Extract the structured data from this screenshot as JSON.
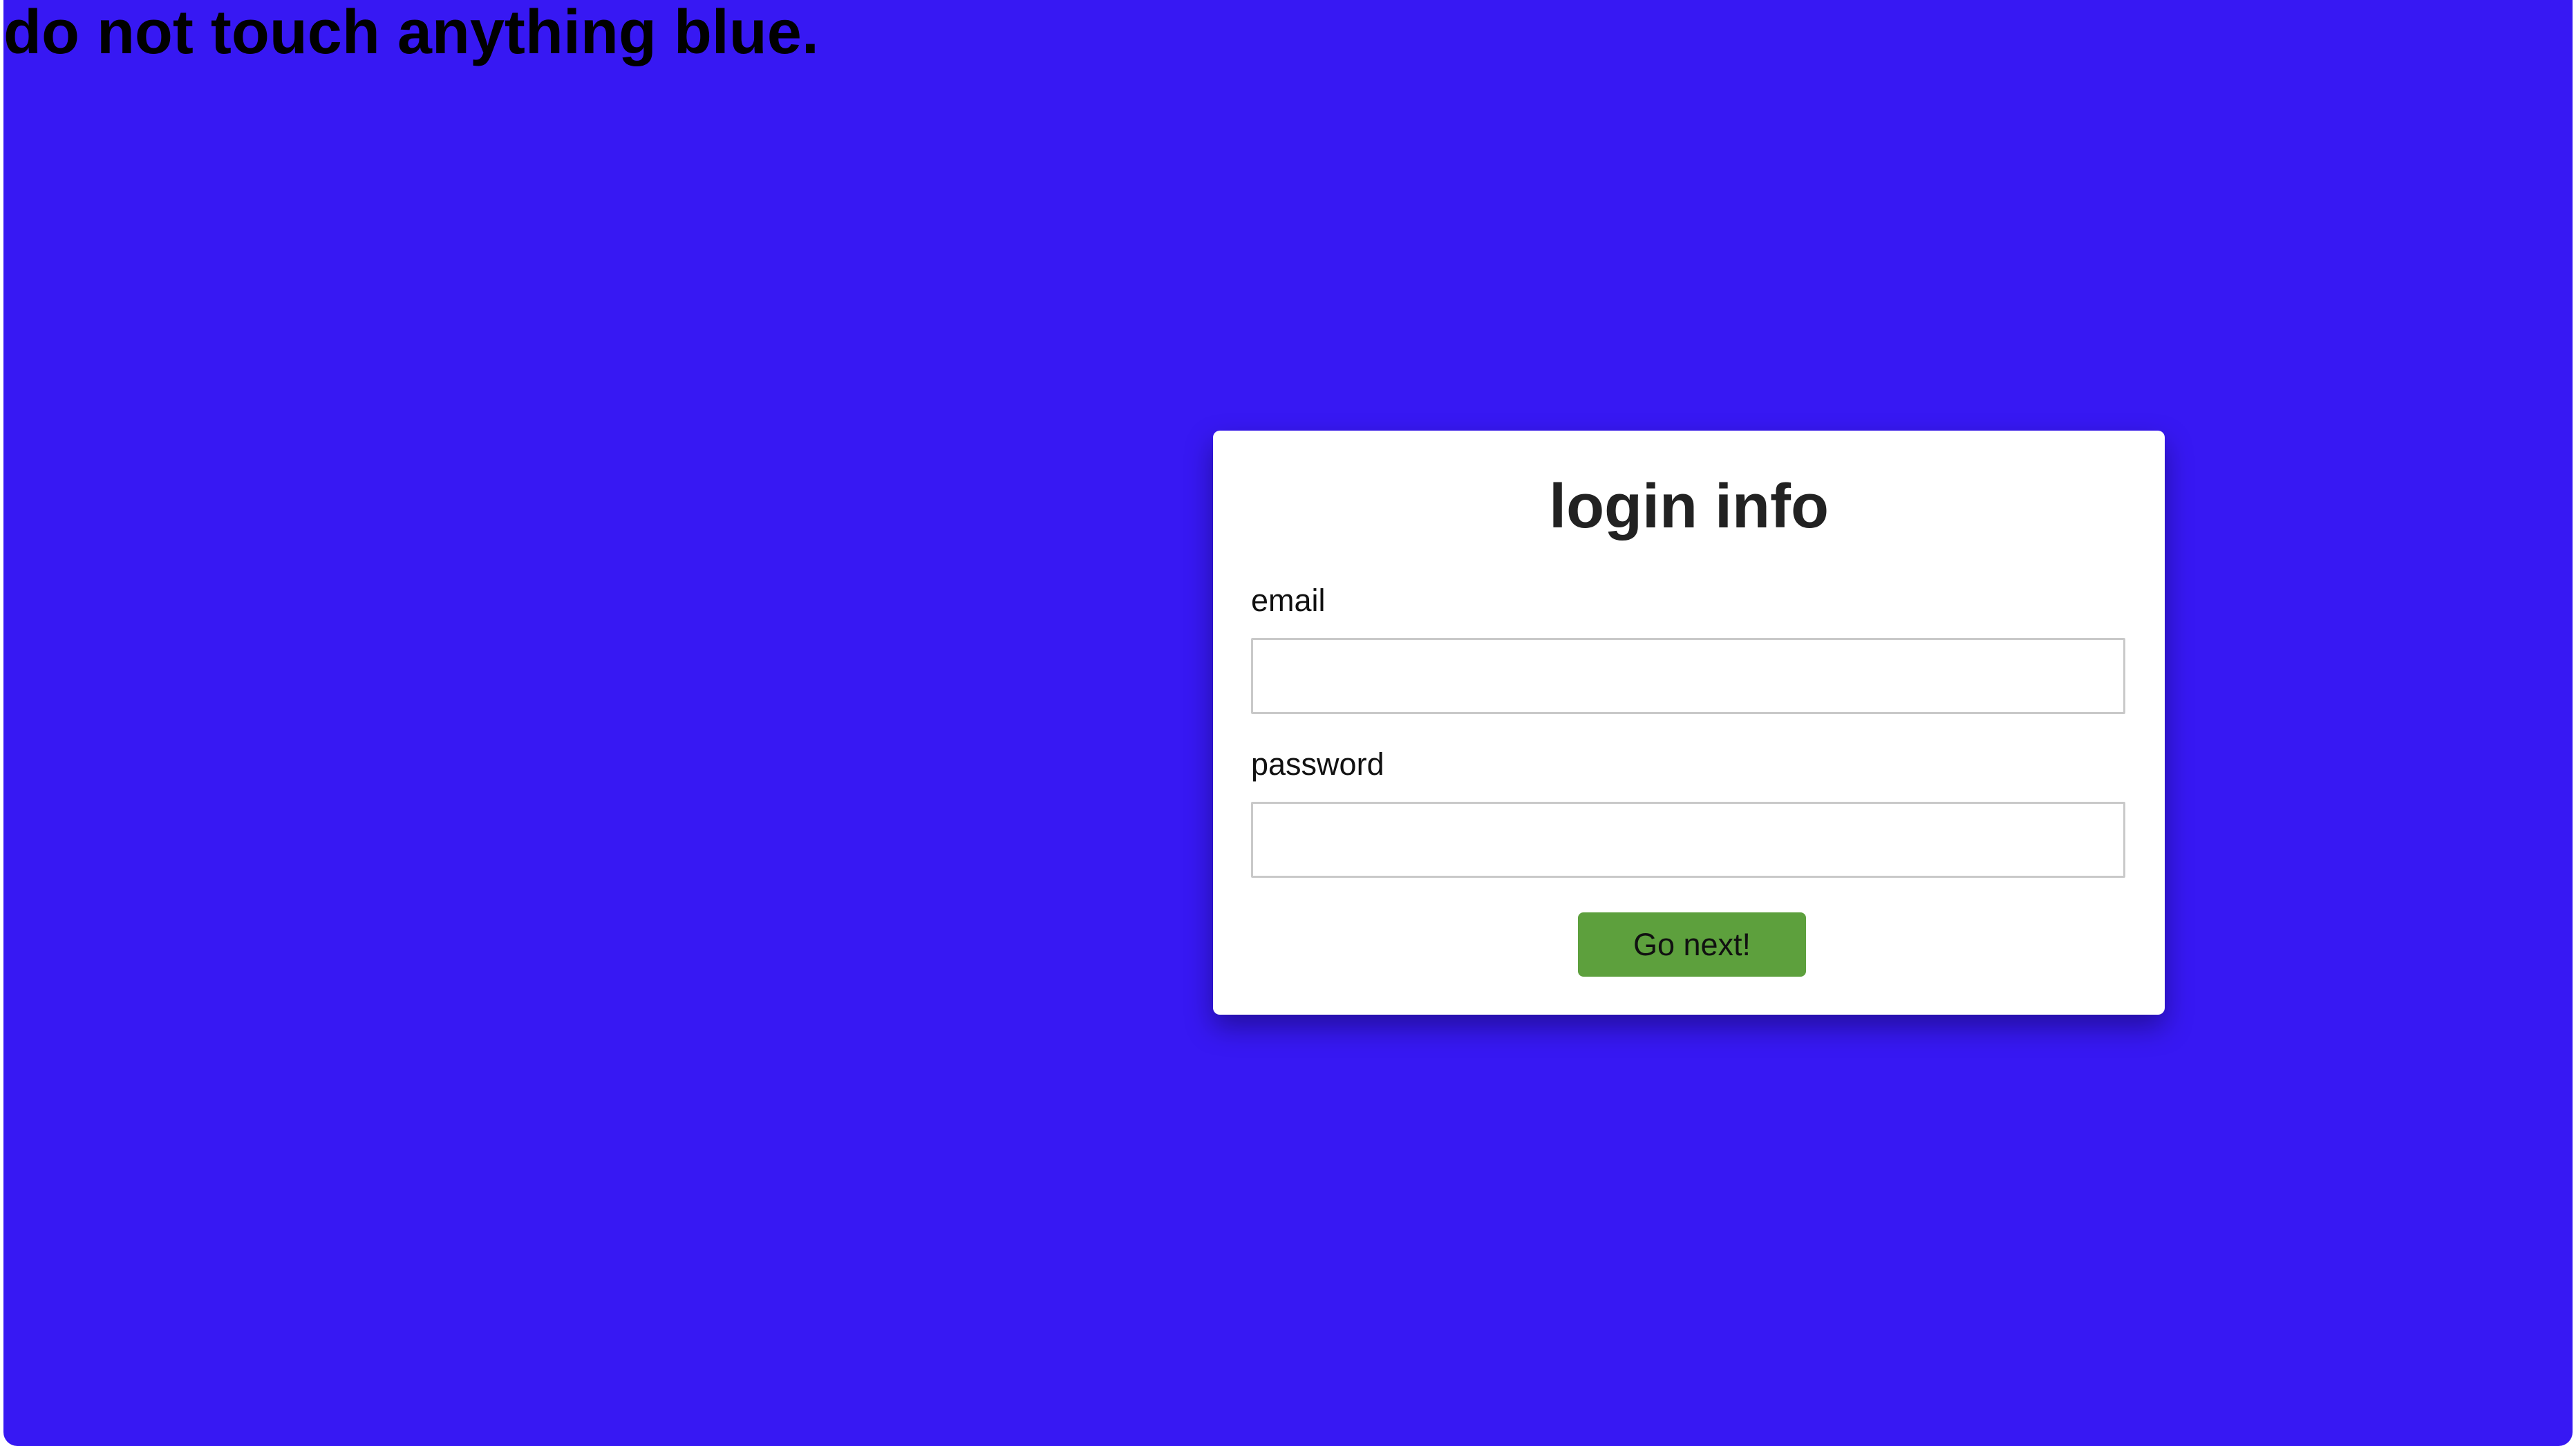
{
  "page": {
    "warning_text": "do not touch anything blue.",
    "background_color": "#3718f3"
  },
  "login_card": {
    "title": "login info",
    "email": {
      "label": "email",
      "value": "",
      "placeholder": ""
    },
    "password": {
      "label": "password",
      "value": "",
      "placeholder": ""
    },
    "submit_label": "Go next!",
    "submit_color": "#5da03d"
  }
}
